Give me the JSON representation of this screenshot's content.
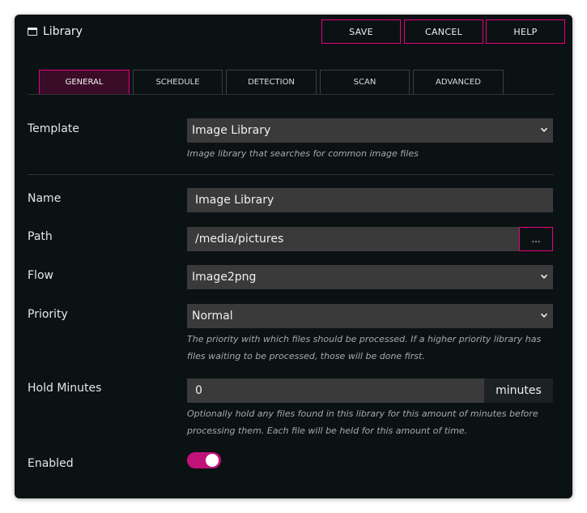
{
  "window": {
    "title": "Library",
    "icon": "window-icon"
  },
  "toolbar": {
    "save_label": "SAVE",
    "cancel_label": "CANCEL",
    "help_label": "HELP"
  },
  "tabs": [
    "GENERAL",
    "SCHEDULE",
    "DETECTION",
    "SCAN",
    "ADVANCED"
  ],
  "form": {
    "template": {
      "label": "Template",
      "value": "Image Library",
      "help": "Image library that searches for common image files"
    },
    "name": {
      "label": "Name",
      "value": "Image Library"
    },
    "path": {
      "label": "Path",
      "value": "/media/pictures",
      "browse_label": "..."
    },
    "flow": {
      "label": "Flow",
      "value": "Image2png"
    },
    "priority": {
      "label": "Priority",
      "value": "Normal",
      "help_line1": "The priority with which files should be processed. If a higher priority library has",
      "help_line2": "files waiting to be processed, those will be done first."
    },
    "hold_minutes": {
      "label": "Hold Minutes",
      "value": "0",
      "suffix": "minutes",
      "help_line1": "Optionally hold any files found in this library for this amount of minutes before",
      "help_line2": "processing them.  Each file will be held for this amount of time."
    },
    "enabled": {
      "label": "Enabled",
      "value": true
    }
  },
  "colors": {
    "accent": "#e6007e",
    "background": "#0b1214",
    "field": "#3a3a3a",
    "toggle_on": "#c2127a"
  }
}
